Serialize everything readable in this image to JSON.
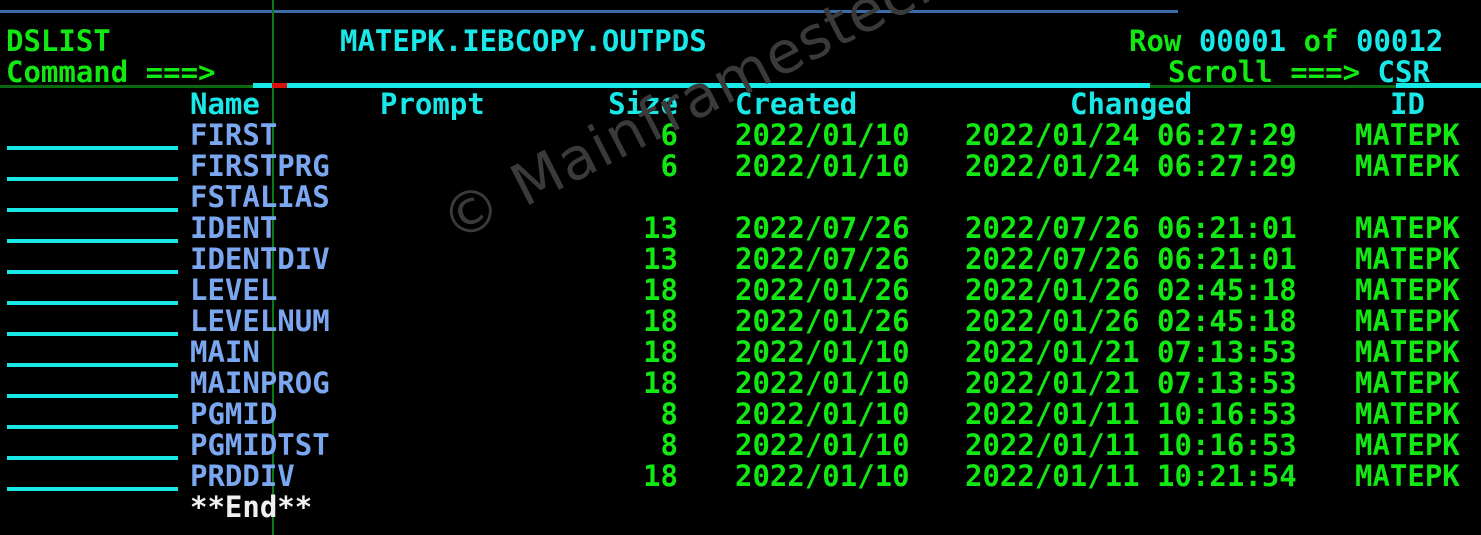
{
  "panel": {
    "app_name": "DSLIST",
    "dataset_title": "MATEPK.IEBCOPY.OUTPDS",
    "row_indicator": "Row 00001 of 00012",
    "row_indicator_parts": {
      "row_word": "Row ",
      "row_number": "00001",
      "of_word": " of ",
      "total_number": "00012"
    },
    "command_label": "Command ===>",
    "command_value": "",
    "scroll_label": "Scroll ===>",
    "scroll_value": "CSR",
    "end_marker": "**End**"
  },
  "columns": {
    "name": "Name",
    "prompt": "Prompt",
    "size": "Size",
    "created": "Created",
    "changed": "Changed",
    "id": "ID"
  },
  "members": [
    {
      "select": "",
      "name": "FIRST",
      "prompt": "",
      "size": "6",
      "created": "2022/01/10",
      "changed": "2022/01/24 06:27:29",
      "id": "MATEPK"
    },
    {
      "select": "",
      "name": "FIRSTPRG",
      "prompt": "",
      "size": "6",
      "created": "2022/01/10",
      "changed": "2022/01/24 06:27:29",
      "id": "MATEPK"
    },
    {
      "select": "",
      "name": "FSTALIAS",
      "prompt": "",
      "size": "",
      "created": "",
      "changed": "",
      "id": ""
    },
    {
      "select": "",
      "name": "IDENT",
      "prompt": "",
      "size": "13",
      "created": "2022/07/26",
      "changed": "2022/07/26 06:21:01",
      "id": "MATEPK"
    },
    {
      "select": "",
      "name": "IDENTDIV",
      "prompt": "",
      "size": "13",
      "created": "2022/07/26",
      "changed": "2022/07/26 06:21:01",
      "id": "MATEPK"
    },
    {
      "select": "",
      "name": "LEVEL",
      "prompt": "",
      "size": "18",
      "created": "2022/01/26",
      "changed": "2022/01/26 02:45:18",
      "id": "MATEPK"
    },
    {
      "select": "",
      "name": "LEVELNUM",
      "prompt": "",
      "size": "18",
      "created": "2022/01/26",
      "changed": "2022/01/26 02:45:18",
      "id": "MATEPK"
    },
    {
      "select": "",
      "name": "MAIN",
      "prompt": "",
      "size": "18",
      "created": "2022/01/10",
      "changed": "2022/01/21 07:13:53",
      "id": "MATEPK"
    },
    {
      "select": "",
      "name": "MAINPROG",
      "prompt": "",
      "size": "18",
      "created": "2022/01/10",
      "changed": "2022/01/21 07:13:53",
      "id": "MATEPK"
    },
    {
      "select": "",
      "name": "PGMID",
      "prompt": "",
      "size": "8",
      "created": "2022/01/10",
      "changed": "2022/01/11 10:16:53",
      "id": "MATEPK"
    },
    {
      "select": "",
      "name": "PGMIDTST",
      "prompt": "",
      "size": "8",
      "created": "2022/01/10",
      "changed": "2022/01/11 10:16:53",
      "id": "MATEPK"
    },
    {
      "select": "",
      "name": "PRDDIV",
      "prompt": "",
      "size": "18",
      "created": "2022/01/10",
      "changed": "2022/01/11 10:21:54",
      "id": "MATEPK"
    }
  ],
  "watermark": {
    "text": "© Mainframestechhelp"
  },
  "colors": {
    "background": "#000000",
    "green": "#12e812",
    "cyan": "#19e8e8",
    "member_blue": "#7aa7f0",
    "white": "#f0f0f0",
    "cursor_red": "#d81010",
    "top_rule_blue": "#3c6ca8",
    "divider_green": "#0a6a10"
  }
}
